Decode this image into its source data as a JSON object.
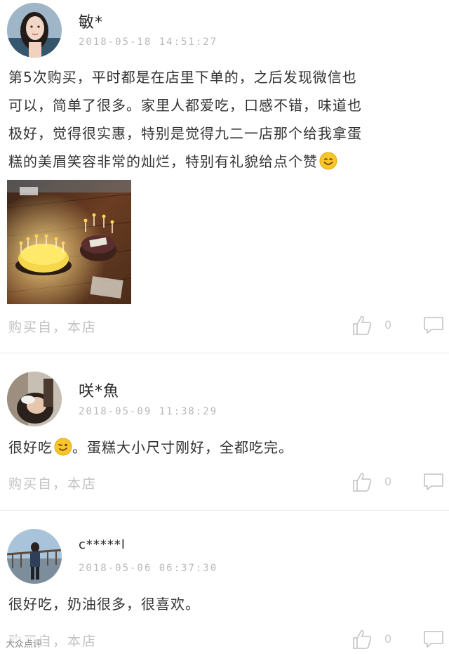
{
  "reviews": [
    {
      "username": "敏*",
      "date": "2018-05-18  14:51:27",
      "content_lines": [
        "第5次购买，平时都是在店里下单的，之后发现微信也",
        "可以，简单了很多。家里人都爱吃，口感不错，味道也",
        "极好，觉得很实惠，特别是觉得九二一店那个给我拿蛋",
        "糕的美眉笑容非常的灿烂，特别有礼貌给点个赞"
      ],
      "source": "购买自，本店",
      "like_count": "0"
    },
    {
      "username": "咲*魚",
      "date": "2018-05-09  11:38:29",
      "content_before": "很好吃",
      "content_after": "。蛋糕大小尺寸刚好，全都吃完。",
      "source": "购买自，本店",
      "like_count": "0"
    },
    {
      "username": "c*****l",
      "date": "2018-05-06  06:37:30",
      "content": "很好吃，奶油很多，很喜欢。",
      "source": "购买自，本店",
      "like_count": "0"
    }
  ],
  "icons": {
    "like": "thumbs-up-icon",
    "comment": "comment-icon",
    "emoji_smile": "smiley-emoji",
    "emoji_wink": "wink-emoji"
  },
  "watermark": "大众点评"
}
